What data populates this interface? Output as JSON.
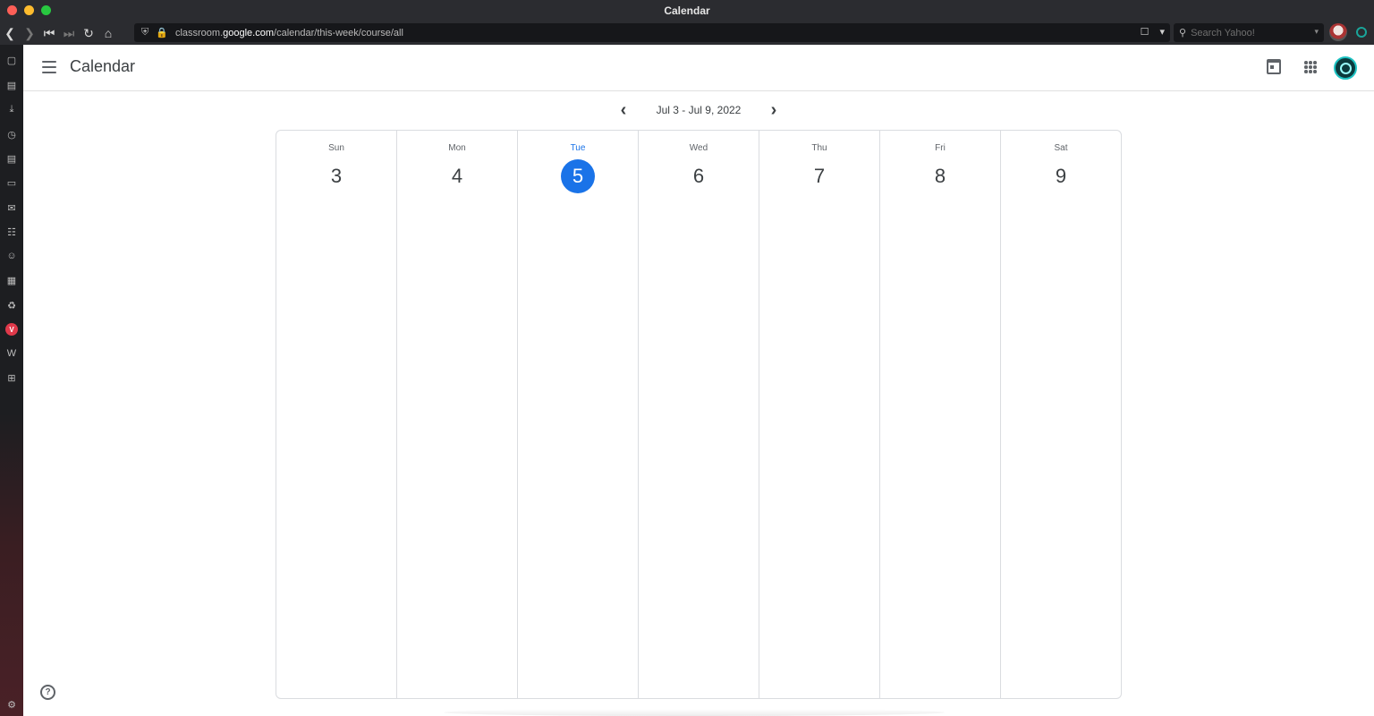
{
  "browser": {
    "window_title": "Calendar",
    "url_prefix": "classroom.",
    "url_host": "google.com",
    "url_path": "/calendar/this-week/course/all",
    "search_placeholder": "Search Yahoo!"
  },
  "app": {
    "title": "Calendar"
  },
  "week": {
    "range_label": "Jul 3 - Jul 9, 2022",
    "days": [
      {
        "name": "Sun",
        "number": "3",
        "today": false
      },
      {
        "name": "Mon",
        "number": "4",
        "today": false
      },
      {
        "name": "Tue",
        "number": "5",
        "today": true
      },
      {
        "name": "Wed",
        "number": "6",
        "today": false
      },
      {
        "name": "Thu",
        "number": "7",
        "today": false
      },
      {
        "name": "Fri",
        "number": "8",
        "today": false
      },
      {
        "name": "Sat",
        "number": "9",
        "today": false
      }
    ]
  },
  "colors": {
    "today_accent": "#1a73e8"
  },
  "icons": {
    "back": "chevron-left-icon",
    "forward": "chevron-right-icon",
    "menu": "hamburger-menu-icon",
    "calendar": "calendar-icon",
    "apps": "apps-grid-icon",
    "help": "help-icon"
  }
}
